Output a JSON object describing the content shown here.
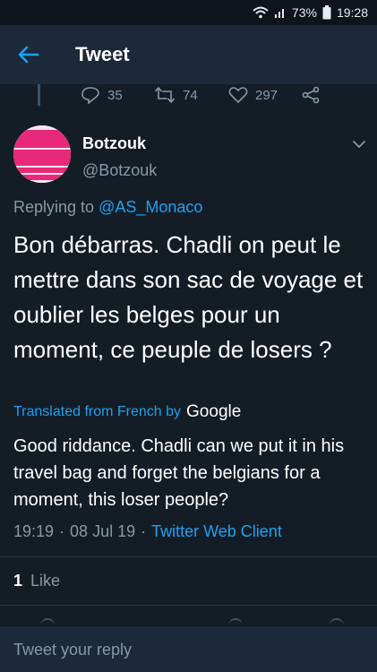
{
  "status_bar": {
    "battery": "73%",
    "time": "19:28"
  },
  "app_bar": {
    "title": "Tweet"
  },
  "previous_tweet_actions": {
    "replies": "35",
    "retweets": "74",
    "likes": "297"
  },
  "tweet": {
    "author_name": "Botzouk",
    "author_handle": "@Botzouk",
    "replying_prefix": "Replying to",
    "replying_to": "@AS_Monaco",
    "text": "Bon débarras. Chadli on peut le mettre dans son sac de voyage et oublier les belges pour un moment, ce peuple de losers ?",
    "translated_label": "Translated from French by",
    "translated_provider": "Google",
    "translation": "Good riddance. Chadli can we put it in his travel bag and forget the belgians for a moment, this loser people?",
    "time": "19:19",
    "date": "08 Jul 19",
    "client": "Twitter Web Client",
    "like_count": "1",
    "like_label": "Like"
  },
  "reply_bar": {
    "placeholder": "Tweet your reply"
  },
  "colors": {
    "background": "#141d26",
    "bar": "#1c2938",
    "accent": "#1da1f2",
    "muted": "#8899a6"
  },
  "icons": [
    "wifi-icon",
    "signal-icon",
    "battery-icon",
    "back-arrow-icon",
    "reply-icon",
    "retweet-icon",
    "heart-icon",
    "share-icon",
    "chevron-down-icon"
  ]
}
